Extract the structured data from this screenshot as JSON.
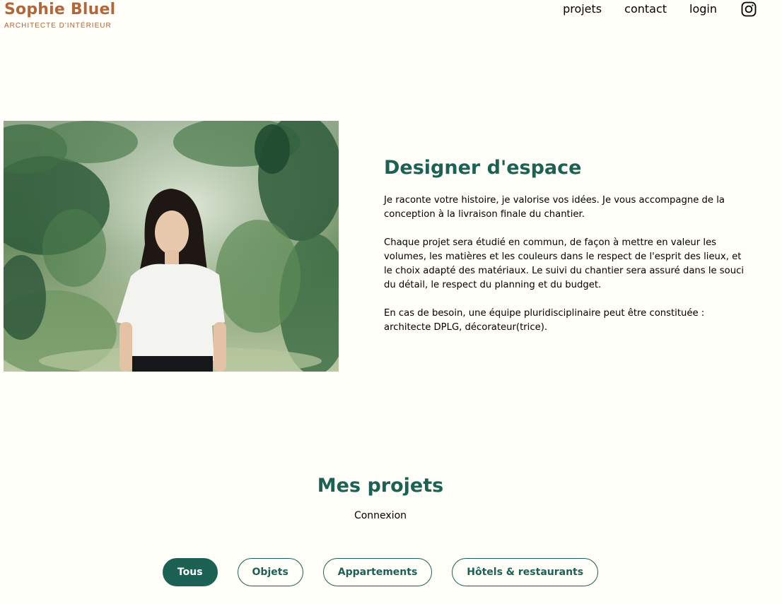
{
  "header": {
    "logo_title": "Sophie Bluel",
    "logo_subtitle": "ARCHITECTE D'INTÉRIEUR",
    "nav": {
      "projects": "projets",
      "contact": "contact",
      "login": "login"
    },
    "instagram_icon": "instagram-icon"
  },
  "intro": {
    "image_icon": "portrait-photo",
    "title": "Designer d'espace",
    "paragraphs": [
      "Je raconte votre histoire, je valorise vos idées. Je vous accompagne de la conception à la livraison finale du chantier.",
      "Chaque projet sera étudié en commun, de façon à mettre en valeur les volumes, les matières et les couleurs dans le respect de l'esprit des lieux, et le choix adapté des matériaux. Le suivi du chantier sera assuré dans le souci du détail, le respect du planning et du budget.",
      "En cas de besoin, une équipe pluridisciplinaire peut être constituée : architecte DPLG, décorateur(trice)."
    ]
  },
  "projects": {
    "title": "Mes projets",
    "connexion": "Connexion",
    "filters": [
      "Tous",
      "Objets",
      "Appartements",
      "Hôtels & restaurants"
    ],
    "active_filter": "Tous"
  },
  "colors": {
    "accent": "#1D6154",
    "brand": "#B1663C",
    "background": "#FFFEF8"
  }
}
